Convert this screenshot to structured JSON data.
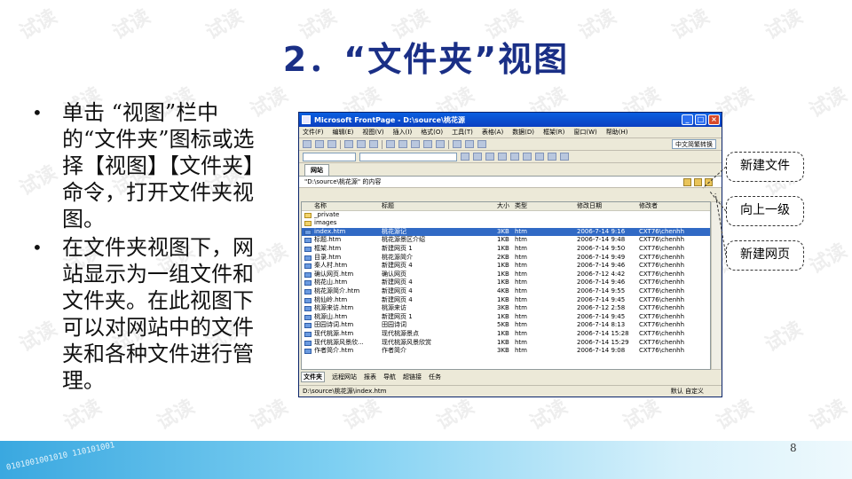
{
  "watermark": "试读",
  "title": "2．“文件夹”视图",
  "bullets": [
    "单击 “视图”栏中的“文件夹”图标或选择【视图】【文件夹】命令，打开文件夹视图。",
    "在文件夹视图下，网站显示为一组文件和文件夹。在此视图下可以对网站中的文件夹和各种文件进行管理。"
  ],
  "window": {
    "title": "Microsoft FrontPage - D:\\source\\桃花源",
    "menu": [
      "文件(F)",
      "编辑(E)",
      "视图(V)",
      "插入(I)",
      "格式(O)",
      "工具(T)",
      "表格(A)",
      "数据(D)",
      "框架(R)",
      "窗口(W)",
      "帮助(H)"
    ],
    "toolbar_select": "中文简繁转换",
    "site_tab": "网站",
    "path": "\"D:\\source\\桃花源\" 的内容",
    "columns": [
      "名称",
      "标题",
      "大小",
      "类型",
      "修改日期",
      "修改者"
    ],
    "files": [
      {
        "name": "_private",
        "title": "",
        "size": "",
        "type": "",
        "date": "",
        "by": "",
        "folder": true
      },
      {
        "name": "images",
        "title": "",
        "size": "",
        "type": "",
        "date": "",
        "by": "",
        "folder": true
      },
      {
        "name": "index.htm",
        "title": "桃花源记",
        "size": "3KB",
        "type": "htm",
        "date": "2006-7-14 9:16",
        "by": "CXT76\\chenhh",
        "selected": true
      },
      {
        "name": "标题.htm",
        "title": "桃花源景区介绍",
        "size": "1KB",
        "type": "htm",
        "date": "2006-7-14 9:48",
        "by": "CXT76\\chenhh"
      },
      {
        "name": "框架.htm",
        "title": "新建网页 1",
        "size": "1KB",
        "type": "htm",
        "date": "2006-7-14 9:50",
        "by": "CXT76\\chenhh"
      },
      {
        "name": "目录.htm",
        "title": "桃花源简介",
        "size": "2KB",
        "type": "htm",
        "date": "2006-7-14 9:49",
        "by": "CXT76\\chenhh"
      },
      {
        "name": "秦人村.htm",
        "title": "新建网页 4",
        "size": "1KB",
        "type": "htm",
        "date": "2006-7-14 9:46",
        "by": "CXT76\\chenhh"
      },
      {
        "name": "确认网页.htm",
        "title": "确认网页",
        "size": "1KB",
        "type": "htm",
        "date": "2006-7-12 4:42",
        "by": "CXT76\\chenhh"
      },
      {
        "name": "桃花山.htm",
        "title": "新建网页 4",
        "size": "1KB",
        "type": "htm",
        "date": "2006-7-14 9:46",
        "by": "CXT76\\chenhh"
      },
      {
        "name": "桃花源简介.htm",
        "title": "新建网页 4",
        "size": "4KB",
        "type": "htm",
        "date": "2006-7-14 9:55",
        "by": "CXT76\\chenhh"
      },
      {
        "name": "桃仙岭.htm",
        "title": "新建网页 4",
        "size": "1KB",
        "type": "htm",
        "date": "2006-7-14 9:45",
        "by": "CXT76\\chenhh"
      },
      {
        "name": "桃源来访.htm",
        "title": "桃源来访",
        "size": "3KB",
        "type": "htm",
        "date": "2006-7-12 2:58",
        "by": "CXT76\\chenhh"
      },
      {
        "name": "桃源山.htm",
        "title": "新建网页 1",
        "size": "1KB",
        "type": "htm",
        "date": "2006-7-14 9:45",
        "by": "CXT76\\chenhh"
      },
      {
        "name": "田园诗词.htm",
        "title": "田园诗词",
        "size": "5KB",
        "type": "htm",
        "date": "2006-7-14 8:13",
        "by": "CXT76\\chenhh"
      },
      {
        "name": "现代桃源.htm",
        "title": "现代桃源景点",
        "size": "1KB",
        "type": "htm",
        "date": "2006-7-14 15:28",
        "by": "CXT76\\chenhh"
      },
      {
        "name": "现代桃源风景欣...",
        "title": "现代桃源风景欣赏",
        "size": "1KB",
        "type": "htm",
        "date": "2006-7-14 15:29",
        "by": "CXT76\\chenhh"
      },
      {
        "name": "作者简介.htm",
        "title": "作者简介",
        "size": "3KB",
        "type": "htm",
        "date": "2006-7-14 9:08",
        "by": "CXT76\\chenhh"
      }
    ],
    "view_tabs": [
      "文件夹",
      "远程网站",
      "报表",
      "导航",
      "超链接",
      "任务"
    ],
    "status_path": "D:\\source\\桃花源\\index.htm",
    "status_right": "默认  自定义"
  },
  "callouts": [
    "新建文件",
    "向上一级",
    "新建网页"
  ],
  "footer_binary": "0101001001010 110101001",
  "page_number": "8"
}
